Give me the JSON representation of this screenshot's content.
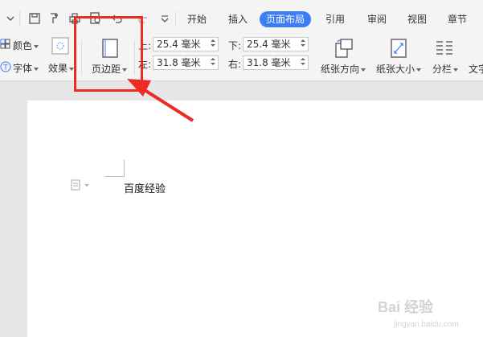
{
  "tabs": [
    {
      "label": "开始",
      "active": false
    },
    {
      "label": "插入",
      "active": false
    },
    {
      "label": "页面布局",
      "active": true
    },
    {
      "label": "引用",
      "active": false
    },
    {
      "label": "审阅",
      "active": false
    },
    {
      "label": "视图",
      "active": false
    },
    {
      "label": "章节",
      "active": false
    }
  ],
  "ribbon": {
    "color_label": "颜色",
    "font_label": "字体",
    "effect_label": "效果",
    "margins_label": "页边距",
    "orientation_label": "纸张方向",
    "size_label": "纸张大小",
    "columns_label": "分栏",
    "text_direction_label": "文字",
    "margins": {
      "top_label": "上:",
      "top_value": "25.4 毫米",
      "bottom_label": "下:",
      "bottom_value": "25.4 毫米",
      "left_label": "左:",
      "left_value": "31.8 毫米",
      "right_label": "右:",
      "right_value": "31.8 毫米"
    }
  },
  "document": {
    "text": "百度经验"
  },
  "watermark": {
    "main": "Bai 经验",
    "sub": "jingyan.baidu.com"
  },
  "colors": {
    "active_tab": "#3d7cf4",
    "highlight": "#ee2a24"
  }
}
